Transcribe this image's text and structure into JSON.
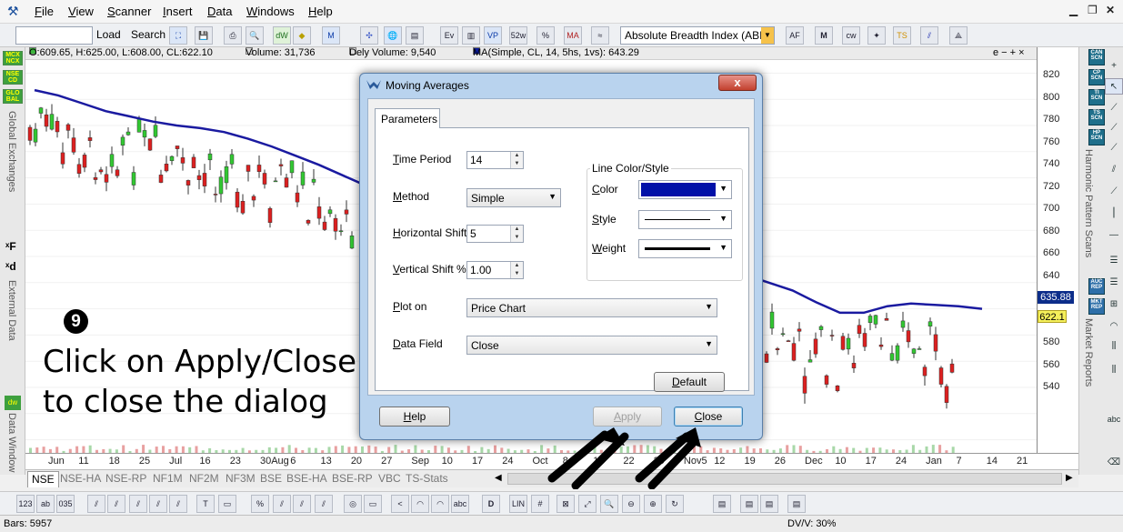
{
  "menubar": {
    "items": [
      "File",
      "View",
      "Scanner",
      "Insert",
      "Data",
      "Windows",
      "Help"
    ]
  },
  "toolbar": {
    "load_label": "Load",
    "search_label": "Search",
    "indicator_select": "Absolute Breadth Index (ABI"
  },
  "infobar": {
    "ohlc": "O:609.65, H:625.00, L:608.00, CL:622.10",
    "volume": "Volume: 31,736",
    "dely_volume": "Dely Volume: 9,540",
    "ma": "MA(Simple, CL, 14, 5hs, 1vs): 643.29",
    "controls": "e − + ×"
  },
  "left_panel": {
    "exchanges": [
      "MCX NCX",
      "NSE CD",
      "GLO BAL"
    ],
    "global_exchanges_label": "Global Exchanges",
    "external_data_label": "External Data",
    "data_window_label": "Data Window"
  },
  "right_panel": {
    "scans": [
      "CAN SCN",
      "CP SCN",
      "TI SCN",
      "TS SCN",
      "HP SCN"
    ],
    "harmonic_label": "Harmonic Pattern Scans",
    "reports": [
      "AUC REP",
      "MKT REP"
    ],
    "market_reports_label": "Market Reports"
  },
  "y_axis": {
    "ticks": [
      "820",
      "800",
      "780",
      "760",
      "740",
      "720",
      "700",
      "680",
      "660",
      "640",
      "620",
      "600",
      "580",
      "560",
      "540"
    ],
    "ma_value": "635.88",
    "last_value": "622.1"
  },
  "x_axis": {
    "ticks": [
      "Jun",
      "11",
      "18",
      "25",
      "Jul",
      "16",
      "23",
      "30Aug",
      "6",
      "13",
      "20",
      "27",
      "Sep",
      "10",
      "17",
      "24",
      "Oct",
      "8",
      "15",
      "22",
      "29",
      "Nov5",
      "12",
      "19",
      "26",
      "Dec",
      "10",
      "17",
      "24",
      "Jan",
      "7",
      "14",
      "21"
    ]
  },
  "exchange_tabs": [
    "NSE",
    "NSE-HA",
    "NSE-RP",
    "NF1M",
    "NF2M",
    "NF3M",
    "BSE",
    "BSE-HA",
    "BSE-RP",
    "VBC",
    "TS-Stats"
  ],
  "status": {
    "bars": "Bars: 5957",
    "dv": "DV/V: 30%"
  },
  "annotation": {
    "step": "9",
    "line1": "Click on Apply/Close",
    "line2": "to close the dialog"
  },
  "dialog": {
    "title": "Moving Averages",
    "close_glyph": "x",
    "tab": "Parameters",
    "time_period_label": "Time Period",
    "time_period": "14",
    "method_label": "Method",
    "method": "Simple",
    "hshift_label": "Horizontal Shift",
    "hshift": "5",
    "vshift_label": "Vertical Shift %",
    "vshift": "1.00",
    "plot_on_label": "Plot on",
    "plot_on": "Price Chart",
    "data_field_label": "Data Field",
    "data_field": "Close",
    "line_group_title": "Line Color/Style",
    "color_label": "Color",
    "style_label": "Style",
    "weight_label": "Weight",
    "line_color": "#0010a8",
    "default_button": "Default",
    "help_button": "Help",
    "apply_button": "Apply",
    "close_button": "Close"
  },
  "colors": {
    "ma_line": "#1a1aa0",
    "candle_up": "#32c832",
    "candle_down": "#dc2020"
  },
  "chart_data": {
    "type": "candlestick",
    "ylim": [
      530,
      830
    ],
    "ma_series": [
      807,
      803,
      797,
      791,
      787,
      783,
      780,
      778,
      775,
      770,
      764,
      757,
      750,
      742,
      734,
      726,
      718,
      710,
      703,
      697,
      691,
      686,
      681,
      676,
      671,
      666,
      661,
      655,
      665,
      668,
      666,
      660,
      654,
      645,
      637,
      637,
      642,
      644,
      643,
      642,
      640
    ]
  }
}
